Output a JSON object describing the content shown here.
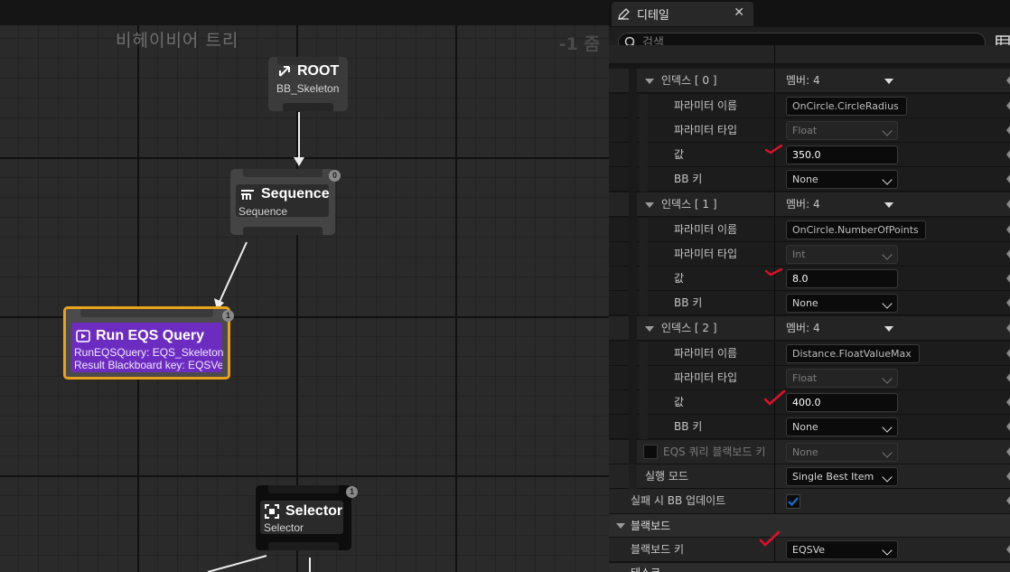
{
  "graph": {
    "title": "비헤이비어 트리",
    "zoom": "-1 줌",
    "nodes": {
      "root": {
        "title": "ROOT",
        "subtitle": "BB_Skeleton"
      },
      "sequence": {
        "title": "Sequence",
        "subtitle": "Sequence",
        "badge": "0"
      },
      "run_eqs": {
        "title": "Run EQS Query",
        "line1": "RunEQSQuery: EQS_Skeleton",
        "line2": "Result Blackboard key: EQSVe",
        "badge": "1"
      },
      "selector": {
        "title": "Selector",
        "subtitle": "Selector",
        "badge": "1"
      }
    }
  },
  "details": {
    "tab_title": "디테일",
    "search_placeholder": "검색",
    "top_partial_label": "",
    "index_label_suffix": "멤버: 4",
    "params": [
      {
        "index_label": "인덱스 [ 0 ]",
        "members": "멤버: 4",
        "name_label": "파라미터 이름",
        "name_value": "OnCircle.CircleRadius",
        "type_label": "파라미터 타입",
        "type_value": "Float",
        "value_label": "값",
        "value": "350.0",
        "bbkey_label": "BB 키",
        "bbkey_value": "None"
      },
      {
        "index_label": "인덱스 [ 1 ]",
        "members": "멤버: 4",
        "name_label": "파라미터 이름",
        "name_value": "OnCircle.NumberOfPoints",
        "type_label": "파라미터 타입",
        "type_value": "Int",
        "value_label": "값",
        "value": "8.0",
        "bbkey_label": "BB 키",
        "bbkey_value": "None"
      },
      {
        "index_label": "인덱스 [ 2 ]",
        "members": "멤버: 4",
        "name_label": "파라미터 이름",
        "name_value": "Distance.FloatValueMax",
        "type_label": "파라미터 타입",
        "type_value": "Float",
        "value_label": "값",
        "value": "400.0",
        "bbkey_label": "BB 키",
        "bbkey_value": "None"
      }
    ],
    "eqs_bb_key": {
      "label": "EQS 쿼리 블랙보드 키",
      "value": "None"
    },
    "run_mode": {
      "label": "실행 모드",
      "value": "Single Best Item"
    },
    "update_bb_on_fail": {
      "label": "실패 시 BB 업데이트",
      "checked": true
    },
    "blackboard_section": "블랙보드",
    "blackboard_key": {
      "label": "블랙보드 키",
      "value": "EQSVe"
    },
    "next_section_partial": "태스크"
  },
  "colors": {
    "accent_orange": "#e8a21a",
    "eqs_purple": "#6d2cc0",
    "check_blue": "#0f6fd0",
    "annotation_red": "#e0102a"
  }
}
